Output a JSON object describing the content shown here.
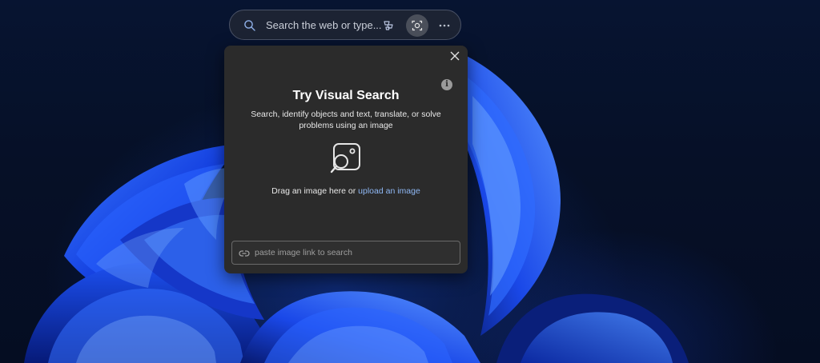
{
  "search_bar": {
    "placeholder": "Search the web or type...",
    "search_icon": "search-icon",
    "copilot_icon": "copilot-icon",
    "visual_search_icon": "visual-search-icon",
    "more_icon": "more-icon"
  },
  "visual_search_panel": {
    "title": "Try Visual Search",
    "description": "Search, identify objects and text, translate, or solve problems using an image",
    "drag_text": "Drag an image here or ",
    "upload_link": "upload an image",
    "link_placeholder": "paste image link to search",
    "info_icon": "info-icon",
    "close_icon": "close-icon",
    "upload_icon": "image-search-icon"
  },
  "colors": {
    "panel_bg": "#2b2b2b",
    "link": "#8fb8f5",
    "wallpaper_accent": "#1f4fff"
  }
}
